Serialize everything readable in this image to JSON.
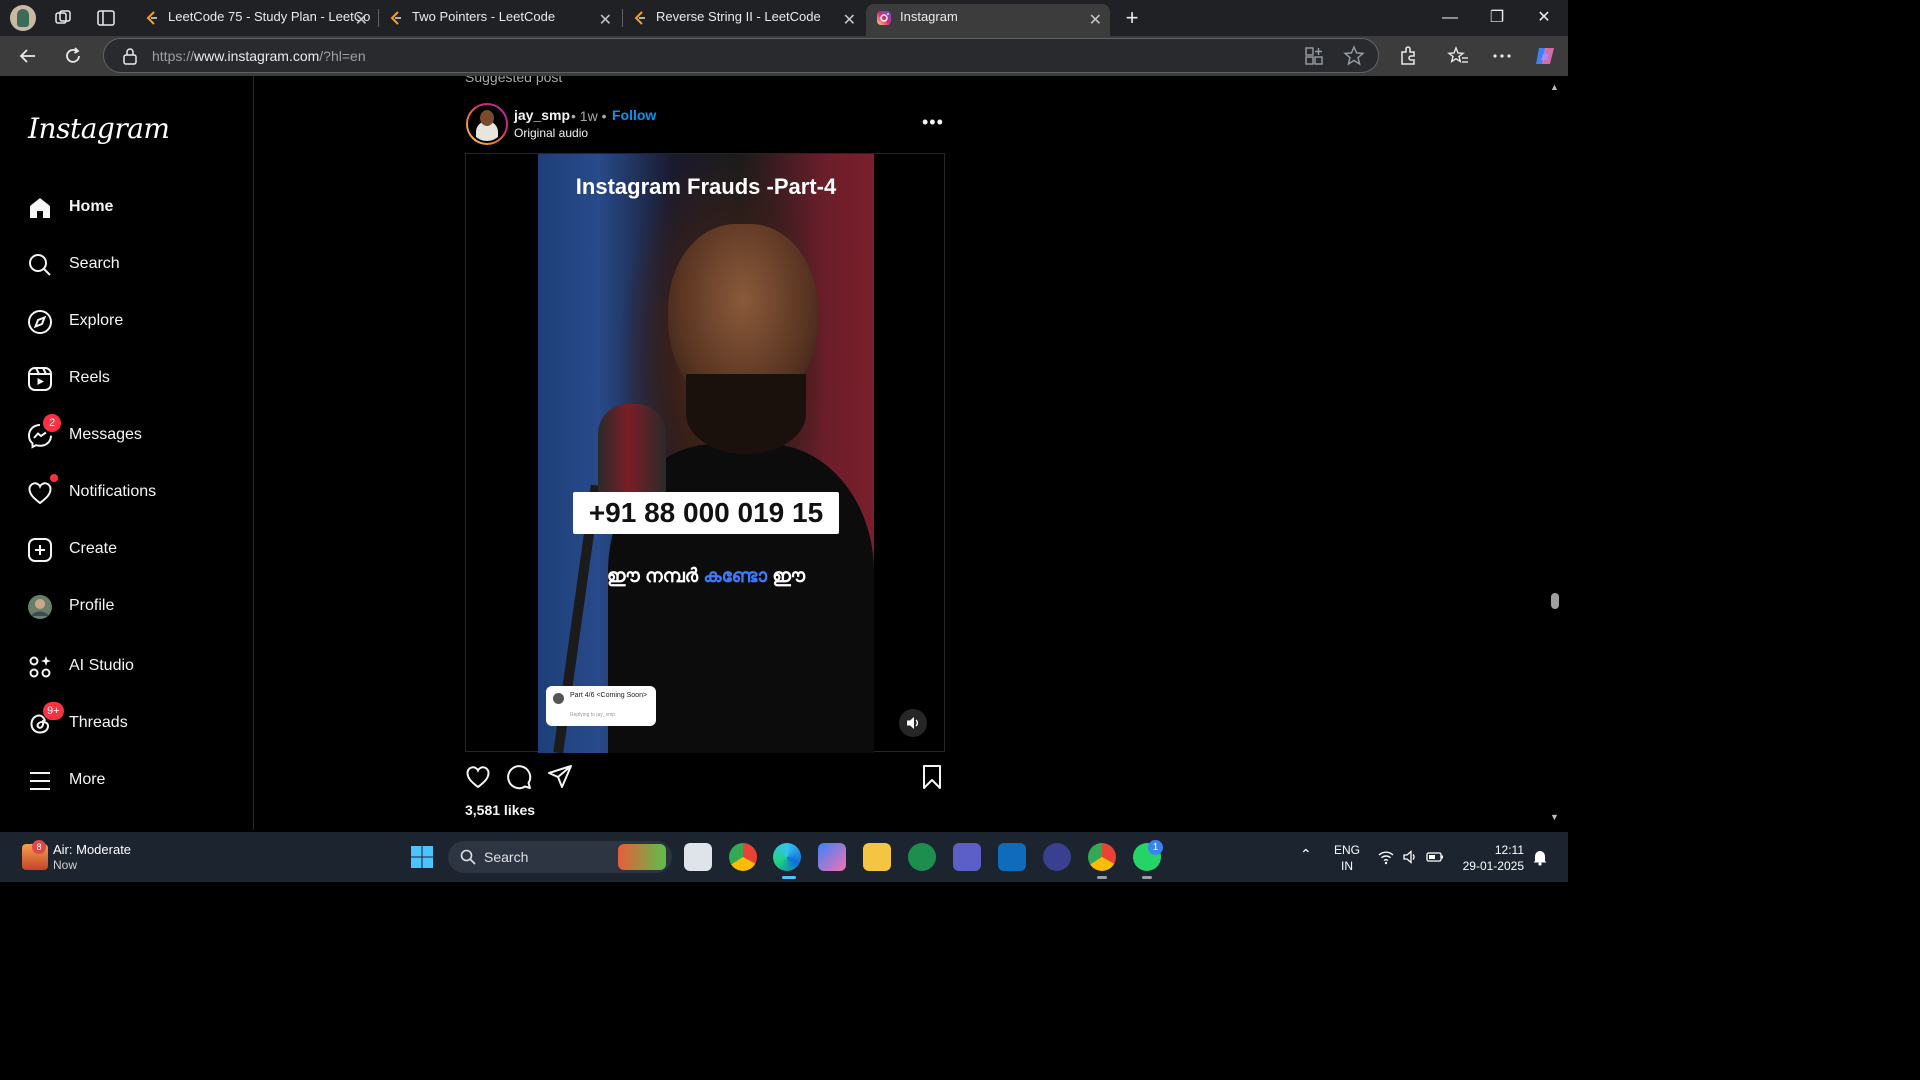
{
  "browser": {
    "tabs": [
      {
        "title": "LeetCode 75 - Study Plan - LeetCo",
        "active": false
      },
      {
        "title": "Two Pointers - LeetCode",
        "active": false
      },
      {
        "title": "Reverse String II - LeetCode",
        "active": false
      },
      {
        "title": "Instagram",
        "active": true
      }
    ],
    "url_prefix": "https://",
    "url_domain": "www.instagram.com",
    "url_suffix": "/?hl=en"
  },
  "instagram": {
    "logo": "Instagram",
    "nav": [
      {
        "label": "Home",
        "icon": "home-icon",
        "active": true
      },
      {
        "label": "Search",
        "icon": "search-icon"
      },
      {
        "label": "Explore",
        "icon": "compass-icon"
      },
      {
        "label": "Reels",
        "icon": "reels-icon"
      },
      {
        "label": "Messages",
        "icon": "messenger-icon",
        "badge": "2"
      },
      {
        "label": "Notifications",
        "icon": "heart-icon",
        "dot": true
      },
      {
        "label": "Create",
        "icon": "plus-square-icon"
      },
      {
        "label": "Profile",
        "icon": "profile-avatar"
      },
      {
        "label": "AI Studio",
        "icon": "ai-studio-icon"
      },
      {
        "label": "Threads",
        "icon": "threads-icon",
        "badge": "9+"
      },
      {
        "label": "More",
        "icon": "hamburger-icon"
      }
    ],
    "post": {
      "suggested_label": "Suggested post",
      "username": "jay_smp",
      "meta": "• 1w •",
      "follow_label": "Follow",
      "audio": "Original audio",
      "video_title": "Instagram Frauds  -Part-4",
      "phone_overlay": "+91 88 000 019 15",
      "malayalam_a": "ഈ നമ്പർ ",
      "malayalam_hl": "കണ്ടോ",
      "malayalam_b": " ഈ",
      "reply_title": "Part 4/6 <Coming Soon>",
      "reply_sub": "Replying to jay_smp",
      "likes": "3,581 likes"
    }
  },
  "taskbar": {
    "weather_badge": "8",
    "weather_title": "Air: Moderate",
    "weather_sub": "Now",
    "search_label": "Search",
    "whatsapp_badge": "1",
    "lang_1": "ENG",
    "lang_2": "IN",
    "time": "12:11",
    "date": "29-01-2025"
  },
  "colors": {
    "follow": "#0095f6",
    "badge": "#ff3040",
    "bg": "#000000"
  }
}
